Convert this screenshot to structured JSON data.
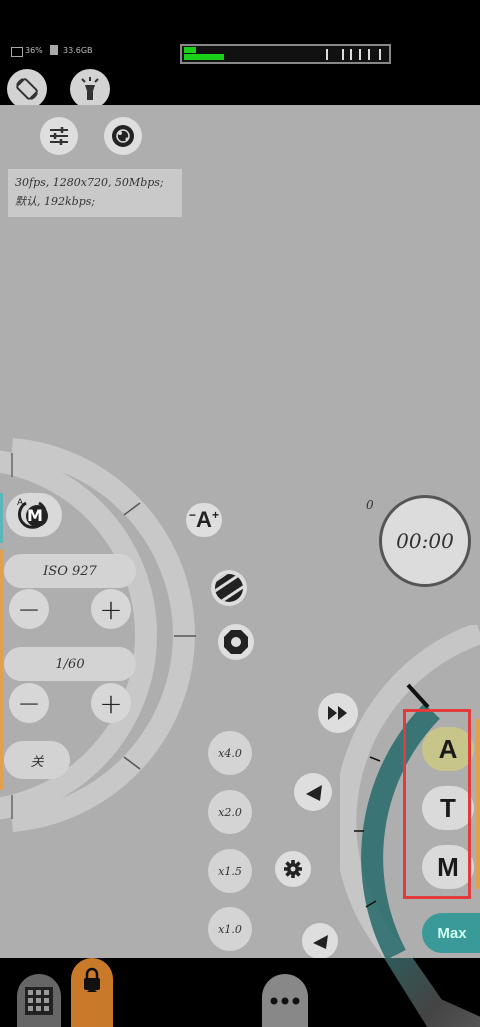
{
  "status": {
    "battery": "36%",
    "storage": "33.6GB"
  },
  "info": {
    "line1": "30fps, 1280x720, 50Mbps;",
    "line2": "默认, 192kbps;"
  },
  "exposure_mode": {
    "label_top": "A",
    "label_main": "M"
  },
  "iso": {
    "label": "ISO 927",
    "minus": "−",
    "plus": "+"
  },
  "shutter": {
    "label": "1/60",
    "minus": "−",
    "plus": "+"
  },
  "toggle_label": "关",
  "af_button_label": "A",
  "counter": "0",
  "timer": "00:00",
  "zoom_levels": [
    "x4.0",
    "x2.0",
    "x1.5",
    "x1.0"
  ],
  "focus_modes": [
    "A",
    "T",
    "M"
  ],
  "max_label": "Max",
  "colors": {
    "accent_teal": "#2f6e6e",
    "highlight_red": "#e23b3b",
    "record_orange": "#c87a2a",
    "level_green": "#19d119",
    "focus_a_bg": "#c7c58a",
    "max_bg": "#3a9a9a"
  }
}
